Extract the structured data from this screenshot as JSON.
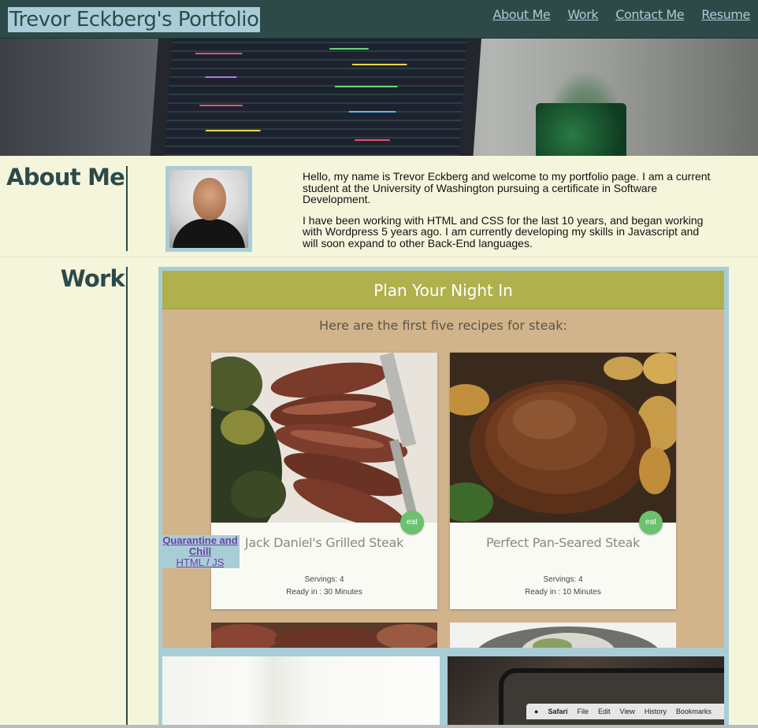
{
  "header": {
    "title": "Trevor Eckberg's Portfolio",
    "nav": [
      "About Me",
      "Work",
      "Contact Me",
      "Resume"
    ]
  },
  "about": {
    "heading": "About Me",
    "paragraphs": [
      "Hello, my name is Trevor Eckberg and welcome to my portfolio page. I am a current student at the University of Washington pursuing a certificate in Software Development.",
      "I have been working with HTML and CSS for the last 10 years, and began working with Wordpress 5 years ago. I am currently developing my skills in Javascript and will soon expand to other Back-End languages."
    ]
  },
  "work": {
    "heading": "Work",
    "featured": {
      "app_title": "Plan Your Night In",
      "subtitle": "Here are the first five recipes for steak:",
      "recipes": [
        {
          "title": "Jack Daniel's Grilled Steak",
          "servings": "Servings: 4",
          "ready": "Ready in : 30 Minutes",
          "badge": "eat"
        },
        {
          "title": "Perfect Pan-Seared Steak",
          "servings": "Servings: 4",
          "ready": "Ready in : 10 Minutes",
          "badge": "eat"
        }
      ],
      "label_name": "Quarantine and Chill",
      "label_tech": "HTML / JS"
    },
    "safari_menu": [
      "Safari",
      "File",
      "Edit",
      "View",
      "History",
      "Bookmarks"
    ]
  },
  "colors": {
    "header_bg": "#2d4a49",
    "accent": "#a9cdd6",
    "page_bg": "#f5f5dc",
    "app_header": "#b0b14d",
    "app_bg": "#d2b48c",
    "badge": "#6cc16f"
  }
}
